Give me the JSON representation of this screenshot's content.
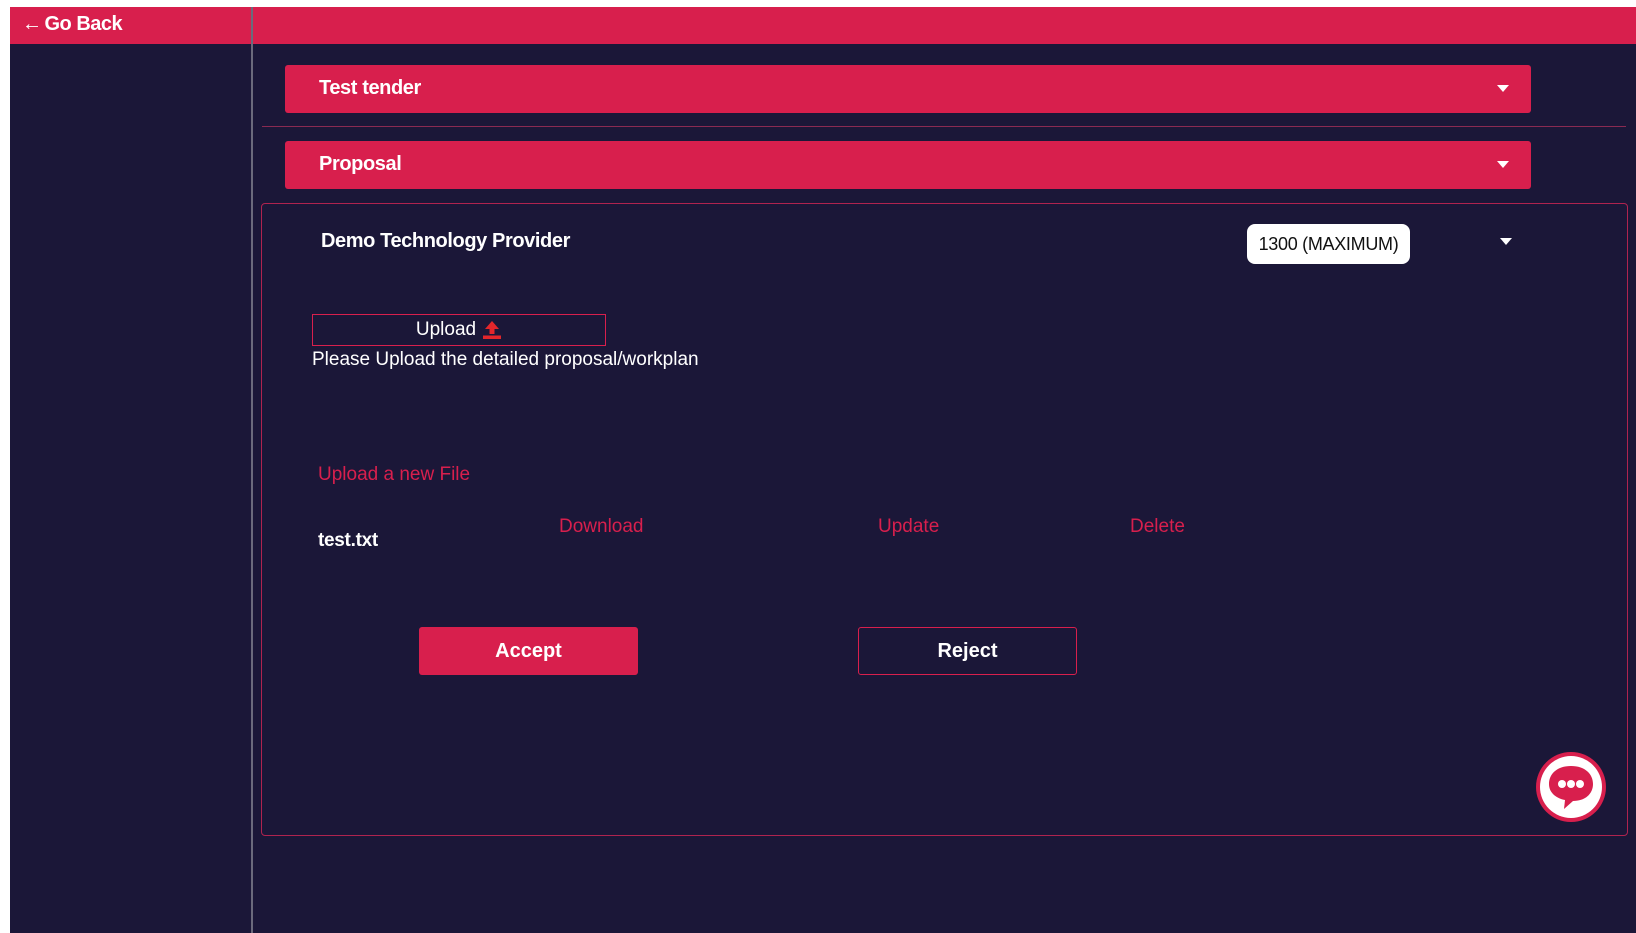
{
  "nav": {
    "go_back_arrow": "←",
    "go_back_label": "Go Back"
  },
  "sections": {
    "tender": {
      "title": "Test tender",
      "icon": "caret-down-icon"
    },
    "proposal": {
      "title": "Proposal",
      "icon": "caret-down-icon"
    }
  },
  "panel": {
    "provider_name": "Demo Technology Provider",
    "score_label": "1300 (MAXIMUM)",
    "upload_button_label": "Upload",
    "upload_icon": "upload-icon",
    "upload_hint": "Please Upload the detailed proposal/workplan",
    "upload_new_file_link": "Upload a new File",
    "files": [
      {
        "name": "test.txt",
        "download_label": "Download",
        "update_label": "Update",
        "delete_label": "Delete"
      }
    ],
    "accept_label": "Accept",
    "reject_label": "Reject"
  },
  "chat": {
    "icon": "chat-bubble-icon"
  },
  "colors": {
    "accent": "#d81f4d",
    "background": "#1b1738",
    "text": "#ffffff",
    "divider": "#6b6a7c"
  }
}
